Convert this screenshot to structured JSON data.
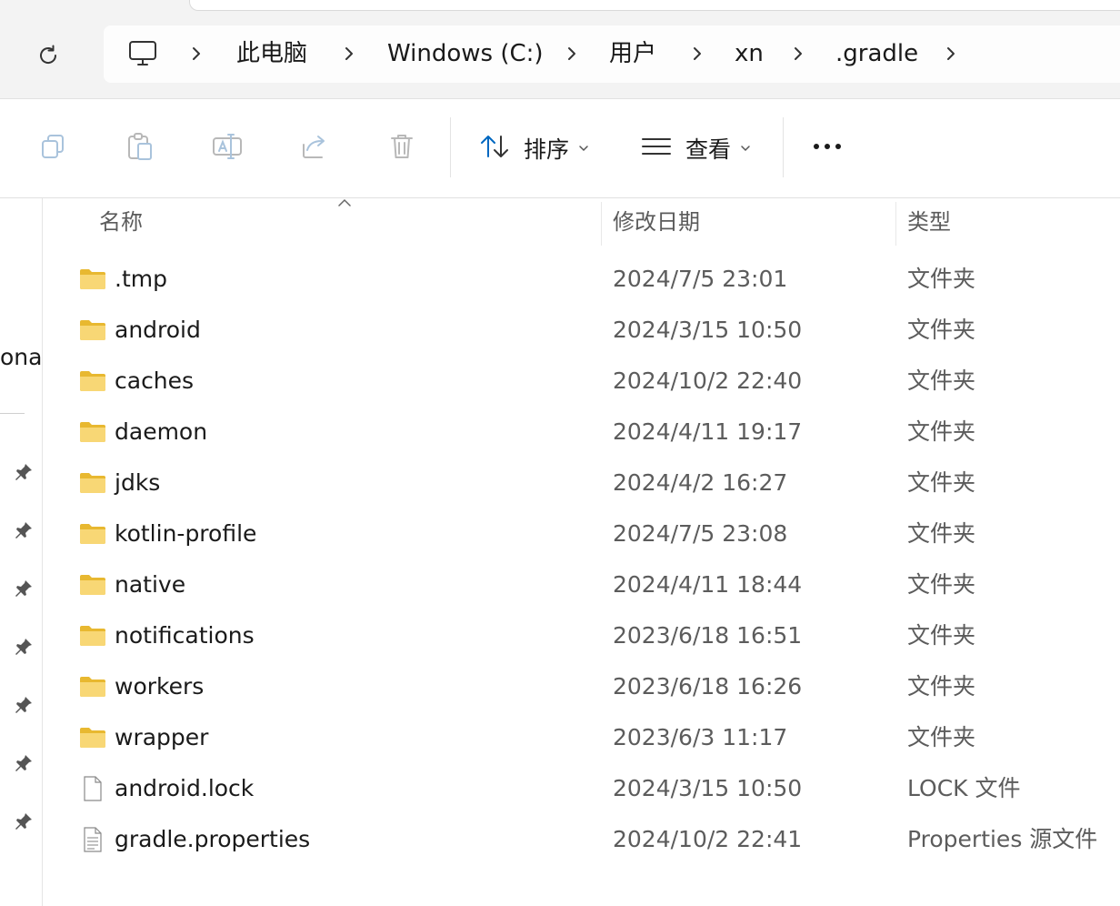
{
  "breadcrumb": {
    "items": [
      "此电脑",
      "Windows (C:)",
      "用户",
      "xn",
      ".gradle"
    ]
  },
  "toolbar": {
    "sort_label": "排序",
    "view_label": "查看"
  },
  "nav": {
    "partial_label": "ona"
  },
  "columns": {
    "name": "名称",
    "date": "修改日期",
    "type": "类型"
  },
  "files": [
    {
      "name": ".tmp",
      "date": "2024/7/5 23:01",
      "type": "文件夹",
      "icon": "folder-icon"
    },
    {
      "name": "android",
      "date": "2024/3/15 10:50",
      "type": "文件夹",
      "icon": "folder-icon"
    },
    {
      "name": "caches",
      "date": "2024/10/2 22:40",
      "type": "文件夹",
      "icon": "folder-icon"
    },
    {
      "name": "daemon",
      "date": "2024/4/11 19:17",
      "type": "文件夹",
      "icon": "folder-icon"
    },
    {
      "name": "jdks",
      "date": "2024/4/2 16:27",
      "type": "文件夹",
      "icon": "folder-icon"
    },
    {
      "name": "kotlin-profile",
      "date": "2024/7/5 23:08",
      "type": "文件夹",
      "icon": "folder-icon"
    },
    {
      "name": "native",
      "date": "2024/4/11 18:44",
      "type": "文件夹",
      "icon": "folder-icon"
    },
    {
      "name": "notifications",
      "date": "2023/6/18 16:51",
      "type": "文件夹",
      "icon": "folder-icon"
    },
    {
      "name": "workers",
      "date": "2023/6/18 16:26",
      "type": "文件夹",
      "icon": "folder-icon"
    },
    {
      "name": "wrapper",
      "date": "2023/6/3 11:17",
      "type": "文件夹",
      "icon": "folder-icon"
    },
    {
      "name": "android.lock",
      "date": "2024/3/15 10:50",
      "type": "LOCK 文件",
      "icon": "file-icon"
    },
    {
      "name": "gradle.properties",
      "date": "2024/10/2 22:41",
      "type": "Properties 源文件",
      "icon": "text-file-icon"
    }
  ],
  "colors": {
    "folder": "#f8d775",
    "folder_dark": "#e8b830",
    "accent": "#0067c0",
    "disabled_icon": "#a9c3dc"
  }
}
